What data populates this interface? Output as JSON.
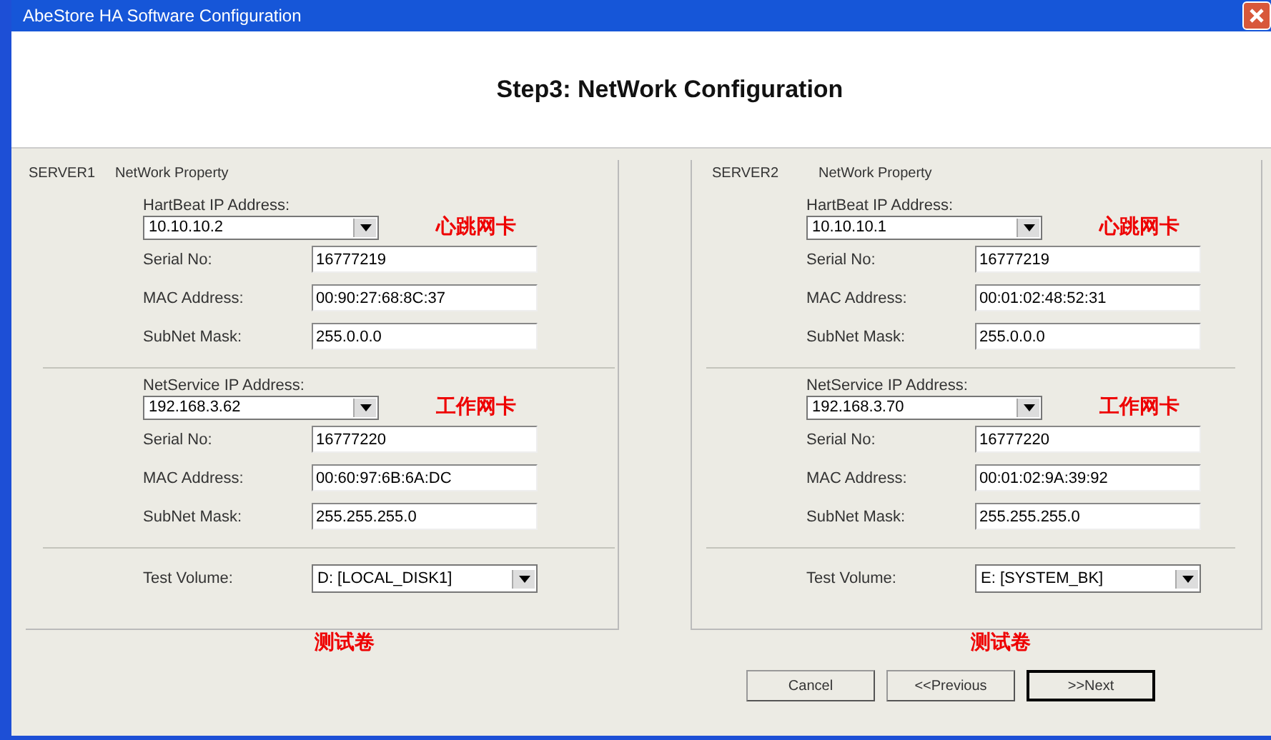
{
  "window": {
    "title": "AbeStore HA Software Configuration"
  },
  "heading": "Step3:  NetWork Configuration",
  "servers": [
    {
      "name": "SERVER1",
      "group_title": "NetWork Property",
      "heartbeat": {
        "label": "HartBeat IP Address:",
        "value": "10.10.10.2",
        "annotation": "心跳网卡",
        "fields": [
          {
            "label": "Serial No:",
            "value": "16777219"
          },
          {
            "label": "MAC Address:",
            "value": "00:90:27:68:8C:37"
          },
          {
            "label": "SubNet Mask:",
            "value": "255.0.0.0"
          }
        ]
      },
      "netservice": {
        "label": "NetService IP Address:",
        "value": "192.168.3.62",
        "annotation": "工作网卡",
        "fields": [
          {
            "label": "Serial No:",
            "value": "16777220"
          },
          {
            "label": "MAC Address:",
            "value": "00:60:97:6B:6A:DC"
          },
          {
            "label": "SubNet Mask:",
            "value": "255.255.255.0"
          }
        ]
      },
      "test_volume": {
        "label": "Test Volume:",
        "value": "D: [LOCAL_DISK1]",
        "annotation": "测试卷"
      }
    },
    {
      "name": "SERVER2",
      "group_title": "NetWork Property",
      "heartbeat": {
        "label": "HartBeat IP Address:",
        "value": "10.10.10.1",
        "annotation": "心跳网卡",
        "fields": [
          {
            "label": "Serial No:",
            "value": "16777219"
          },
          {
            "label": "MAC Address:",
            "value": "00:01:02:48:52:31"
          },
          {
            "label": "SubNet Mask:",
            "value": "255.0.0.0"
          }
        ]
      },
      "netservice": {
        "label": "NetService IP Address:",
        "value": "192.168.3.70",
        "annotation": "工作网卡",
        "fields": [
          {
            "label": "Serial No:",
            "value": "16777220"
          },
          {
            "label": "MAC Address:",
            "value": "00:01:02:9A:39:92"
          },
          {
            "label": "SubNet Mask:",
            "value": "255.255.255.0"
          }
        ]
      },
      "test_volume": {
        "label": "Test Volume:",
        "value": "E: [SYSTEM_BK]",
        "annotation": "测试卷"
      }
    }
  ],
  "buttons": [
    {
      "label": "Cancel",
      "default": false
    },
    {
      "label": "<<Previous",
      "default": false
    },
    {
      "label": ">>Next",
      "default": true
    }
  ]
}
